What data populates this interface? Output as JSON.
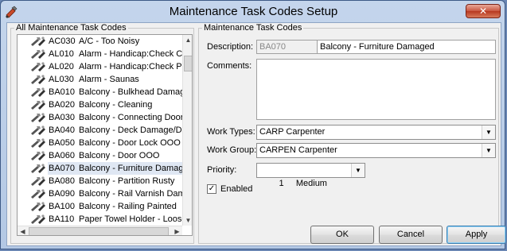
{
  "window": {
    "title": "Maintenance Task Codes Setup",
    "close_label": "✕"
  },
  "left_panel": {
    "caption": "All Maintenance Task Codes",
    "items": [
      {
        "code": "AC030",
        "desc": "A/C - Too Noisy"
      },
      {
        "code": "AL010",
        "desc": "Alarm - Handicap:Check Cab"
      },
      {
        "code": "AL020",
        "desc": "Alarm - Handicap:Check Pub"
      },
      {
        "code": "AL030",
        "desc": "Alarm - Saunas"
      },
      {
        "code": "BA010",
        "desc": "Balcony - Bulkhead Damage,"
      },
      {
        "code": "BA020",
        "desc": "Balcony - Cleaning"
      },
      {
        "code": "BA030",
        "desc": "Balcony - Connecting Door C"
      },
      {
        "code": "BA040",
        "desc": "Balcony - Deck Damage/Dirt"
      },
      {
        "code": "BA050",
        "desc": "Balcony - Door Lock OOO"
      },
      {
        "code": "BA060",
        "desc": "Balcony - Door OOO"
      },
      {
        "code": "BA070",
        "desc": "Balcony - Furniture Damage"
      },
      {
        "code": "BA080",
        "desc": "Balcony - Partition Rusty"
      },
      {
        "code": "BA090",
        "desc": "Balcony - Rail Varnish Damag"
      },
      {
        "code": "BA100",
        "desc": "Balcony - Railing Painted"
      },
      {
        "code": "BA110",
        "desc": "Paper Towel Holder - Loose/"
      }
    ],
    "selected_index": 10
  },
  "right_panel": {
    "caption": "Maintenance Task Codes",
    "description_label": "Description:",
    "code_value": "BA070",
    "description_value": "Balcony - Furniture Damaged",
    "comments_label": "Comments:",
    "comments_value": "",
    "work_types_label": "Work Types:",
    "work_types_value": "CARP Carpenter",
    "work_group_label": "Work Group:",
    "work_group_value": "CARPEN Carpenter",
    "priority_label": "Priority:",
    "priority_value": "1     Medium",
    "enabled_label": "Enabled",
    "enabled_checked": true
  },
  "buttons": {
    "ok": "OK",
    "cancel": "Cancel",
    "apply": "Apply"
  },
  "colors": {
    "selected_row": "#dfe7f3",
    "title_bar": "#c4d5ec",
    "close_button": "#c9563f"
  }
}
